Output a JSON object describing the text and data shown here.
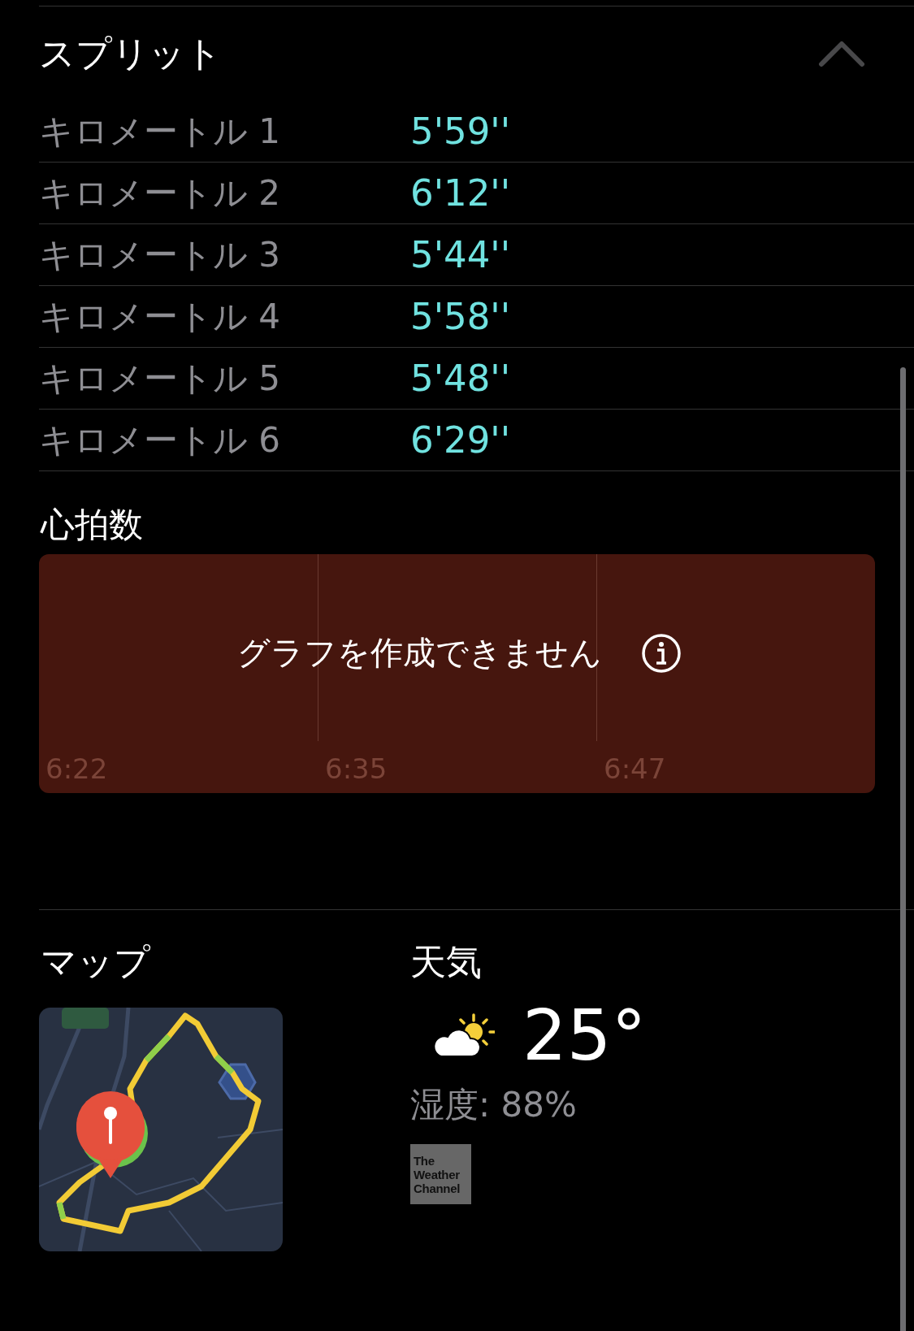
{
  "splits": {
    "title": "スプリット",
    "expanded": true,
    "rows": [
      {
        "label": "キロメートル 1",
        "pace": "5'59''"
      },
      {
        "label": "キロメートル 2",
        "pace": "6'12''"
      },
      {
        "label": "キロメートル 3",
        "pace": "5'44''"
      },
      {
        "label": "キロメートル 4",
        "pace": "5'58''"
      },
      {
        "label": "キロメートル 5",
        "pace": "5'48''"
      },
      {
        "label": "キロメートル 6",
        "pace": "6'29''"
      }
    ]
  },
  "heart_rate": {
    "title": "心拍数",
    "message": "グラフを作成できません",
    "time_labels": [
      "6:22",
      "6:35",
      "6:47"
    ]
  },
  "map": {
    "title": "マップ",
    "kind": "picture"
  },
  "weather": {
    "title": "天気",
    "temperature": "25°",
    "humidity": "湿度: 88%",
    "logo": "The Weather Channel"
  }
}
